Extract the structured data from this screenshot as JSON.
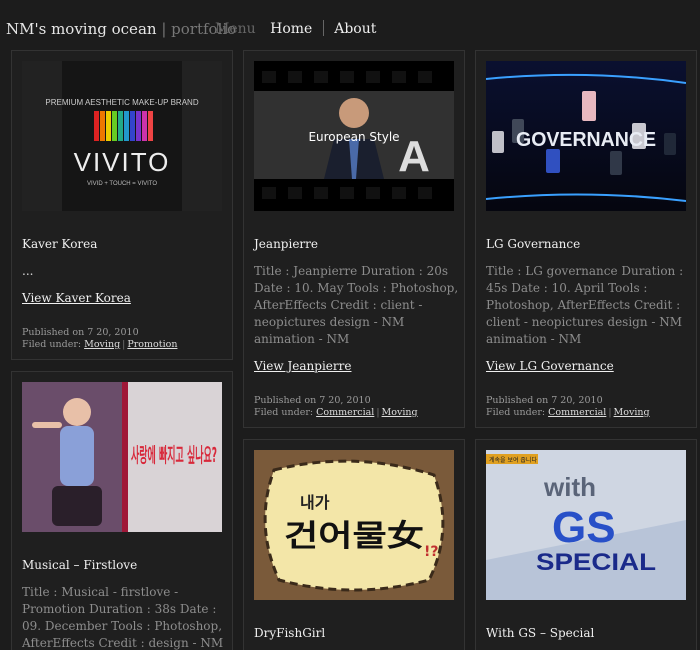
{
  "header": {
    "site_name": "NM's moving ocean",
    "site_sub": "portfolio",
    "menu_label": "Menu",
    "nav": [
      "Home",
      "About"
    ]
  },
  "cards": {
    "kaver": {
      "thumb_text_top": "PREMIUM AESTHETIC MAKE-UP BRAND",
      "thumb_brand": "VIVITO",
      "thumb_tag": "VIVID + TOUCH = VIVITO",
      "title": "Kaver Korea",
      "desc": "...",
      "link": "View Kaver Korea",
      "published": "Published on 7 20, 2010",
      "filed_prefix": "Filed under:",
      "cat1": "Moving",
      "cat2": "Promotion"
    },
    "jeanpierre": {
      "thumb_text": "European Style",
      "thumb_letter": "A",
      "title": "Jeanpierre",
      "desc": "Title : Jeanpierre Duration : 20s Date : 10. May Tools : Photoshop, AfterEffects Credit : client - neopictures design - NM animation - NM",
      "link": "View Jeanpierre",
      "published": "Published on 7 20, 2010",
      "filed_prefix": "Filed under:",
      "cat1": "Commercial",
      "cat2": "Moving"
    },
    "lg": {
      "thumb_text": "GOVERNANCE",
      "title": "LG Governance",
      "desc": "Title : LG governance Duration : 45s Date : 10. April Tools : Photoshop, AfterEffects Credit : client - neopictures design - NM animation - NM",
      "link": "View LG Governance",
      "published": "Published on 7 20, 2010",
      "filed_prefix": "Filed under:",
      "cat1": "Commercial",
      "cat2": "Moving"
    },
    "musical": {
      "thumb_kr": "사랑에 빠지고 싶나요?",
      "title": "Musical – Firstlove",
      "desc": "Title : Musical - firstlove - Promotion Duration : 38s Date : 09. December Tools : Photoshop, AfterEffects Credit : design - NM"
    },
    "dryfish": {
      "thumb_kr_small": "내가",
      "thumb_kr_big": "건어물女",
      "thumb_marks": "!?",
      "title": "DryFishGirl"
    },
    "gs": {
      "thumb_top": "계속을 보여 줍니다",
      "thumb_with": "with",
      "thumb_gs": "GS",
      "thumb_special": "SPECIAL",
      "title": "With GS – Special"
    }
  }
}
